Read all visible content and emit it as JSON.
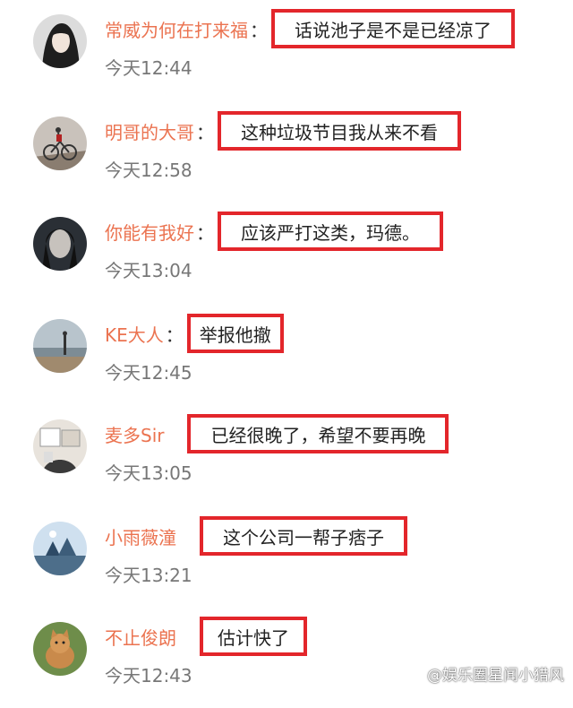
{
  "comments": [
    {
      "username": "常威为何在打来福",
      "text": "话说池子是不是已经凉了",
      "time": "今天12:44"
    },
    {
      "username": "明哥的大哥",
      "text": "这种垃圾节目我从来不看",
      "time": "今天12:58"
    },
    {
      "username": "你能有我好",
      "text": "应该严打这类，玛德。",
      "time": "今天13:04"
    },
    {
      "username": "KE大人",
      "text": "举报他撤",
      "time": "今天12:45"
    },
    {
      "username": "麦多Sir",
      "text": "已经很晚了，希望不要再晚",
      "time": "今天13:05"
    },
    {
      "username": "小雨薇潼",
      "text": "这个公司一帮子痞子",
      "time": "今天13:21"
    },
    {
      "username": "不止俊朗",
      "text": "估计快了",
      "time": "今天12:43"
    }
  ],
  "separator": "：",
  "watermark": "@娱乐圈星闻小猎风",
  "colors": {
    "username": "#eb7350",
    "highlight_border": "#e3262b",
    "time": "#777777"
  }
}
